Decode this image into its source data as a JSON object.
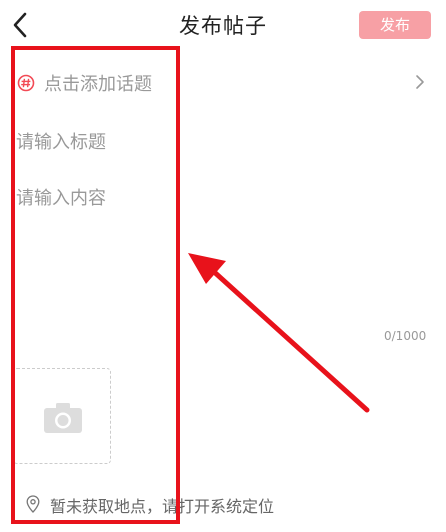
{
  "header": {
    "title": "发布帖子",
    "publish_label": "发布",
    "back_icon": "chevron-left-icon"
  },
  "topic": {
    "icon": "hashtag-circle-icon",
    "label": "点击添加话题",
    "chevron_icon": "chevron-right-icon"
  },
  "title_input": {
    "placeholder": "请输入标题",
    "value": ""
  },
  "content_input": {
    "placeholder": "请输入内容",
    "value": ""
  },
  "char_count": "0/1000",
  "photo": {
    "icon": "camera-icon"
  },
  "location": {
    "icon": "location-pin-icon",
    "text": "暂未获取地点，请打开系统定位"
  },
  "colors": {
    "accent": "#f24a55",
    "publish_bg": "#f7a0a5",
    "annotation": "#e8121b"
  }
}
